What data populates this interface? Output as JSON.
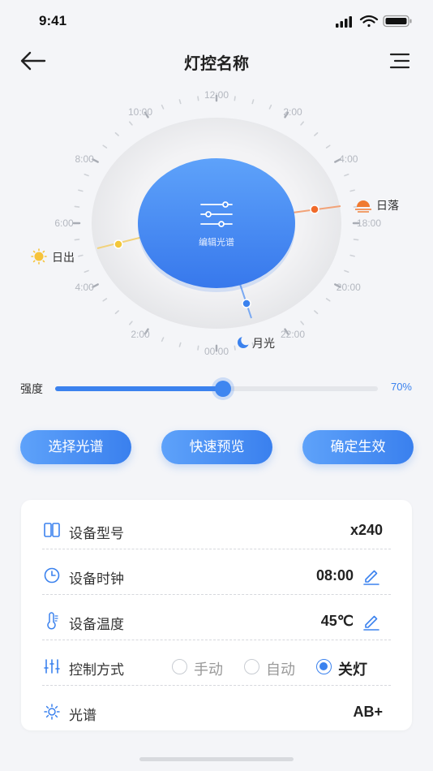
{
  "status_bar": {
    "time": "9:41"
  },
  "nav": {
    "title": "灯控名称"
  },
  "dial": {
    "hour_labels": [
      "12:00",
      "2:00",
      "4:00",
      "18:00",
      "20:00",
      "22:00",
      "00:00",
      "2:00",
      "4:00",
      "6:00",
      "8:00",
      "10:00"
    ],
    "center_label": "编辑光谱",
    "sunrise_label": "日出",
    "sunset_label": "日落",
    "moon_label": "月光",
    "colors": {
      "sunrise": "#f3c73a",
      "sunset": "#f06a2a",
      "moon": "#3b82ee"
    }
  },
  "strength": {
    "label": "强度",
    "value_text": "70%",
    "fill_fraction": 0.52
  },
  "actions": [
    {
      "label": "选择光谱"
    },
    {
      "label": "快速预览"
    },
    {
      "label": "确定生效"
    }
  ],
  "info": {
    "model": {
      "label": "设备型号",
      "value": "x240",
      "icon": "columns-icon"
    },
    "clock": {
      "label": "设备时钟",
      "value": "08:00",
      "icon": "clock-icon"
    },
    "temperature": {
      "label": "设备温度",
      "value": "45℃",
      "icon": "thermometer-icon"
    },
    "control": {
      "label": "控制方式",
      "icon": "sliders-icon",
      "options": [
        {
          "label": "手动",
          "selected": false
        },
        {
          "label": "自动",
          "selected": false
        },
        {
          "label": "关灯",
          "selected": true
        }
      ]
    },
    "spectrum": {
      "label": "光谱",
      "value": "AB+",
      "icon": "sun-icon"
    }
  },
  "accent_color": "#3b82ee"
}
